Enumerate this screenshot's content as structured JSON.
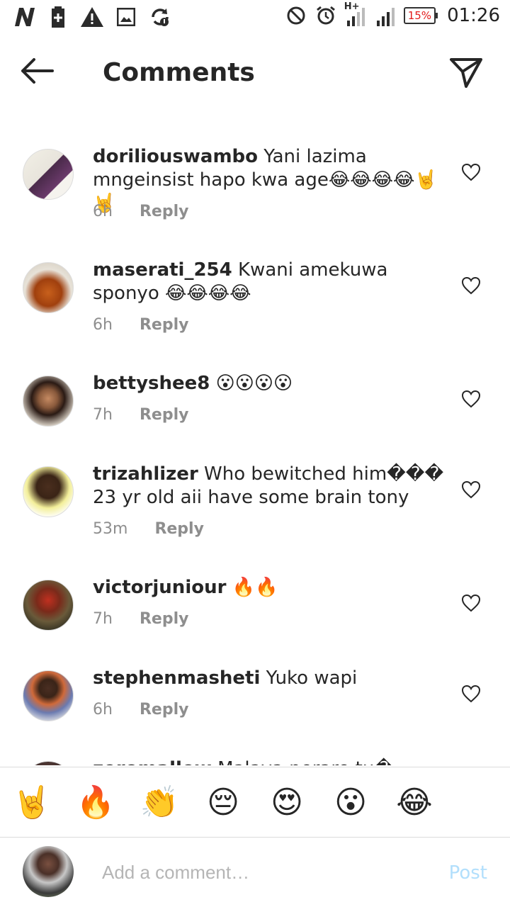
{
  "status_bar": {
    "time": "01:26",
    "battery": "15%",
    "network": "H+",
    "left_icons": [
      "n-logo-icon",
      "battery-plus-icon",
      "warning-icon",
      "image-icon",
      "sync-icon"
    ],
    "right_icons": [
      "do-not-disturb-icon",
      "alarm-icon",
      "signal-icon",
      "signal-icon"
    ]
  },
  "header": {
    "title": "Comments",
    "back_icon": "arrow-left-icon",
    "send_icon": "send-icon"
  },
  "comments": [
    {
      "username": "doriliouswambo",
      "text": "Yani lazima mngeinsist hapo kwa age😂😂😂😂🤘🤘",
      "time": "6h",
      "reply": "Reply"
    },
    {
      "username": "maserati_254",
      "text": "Kwani amekuwa sponyo 😂😂😂😂",
      "time": "6h",
      "reply": "Reply"
    },
    {
      "username": "bettyshee8",
      "text": "😮😮😮😮",
      "time": "7h",
      "reply": "Reply"
    },
    {
      "username": "trizahlizer",
      "text": "Who bewitched him��� 23 yr old aii have some brain tony",
      "time": "53m",
      "reply": "Reply"
    },
    {
      "username": "victorjuniour",
      "text": "🔥🔥",
      "time": "7h",
      "reply": "Reply"
    },
    {
      "username": "stephenmasheti",
      "text": "Yuko wapi",
      "time": "6h",
      "reply": "Reply"
    },
    {
      "username": "zeromallow",
      "text": "Malava perare tu�",
      "time": "",
      "reply": ""
    }
  ],
  "emoji_bar": [
    "🤘",
    "🔥",
    "👏",
    "😔",
    "😍",
    "😮",
    "😂"
  ],
  "composer": {
    "placeholder": "Add a comment…",
    "post_label": "Post"
  },
  "colors": {
    "text": "#262626",
    "meta": "#8e8e8e",
    "post_disabled": "#b2dffc",
    "battery_low": "#e21b1b"
  }
}
